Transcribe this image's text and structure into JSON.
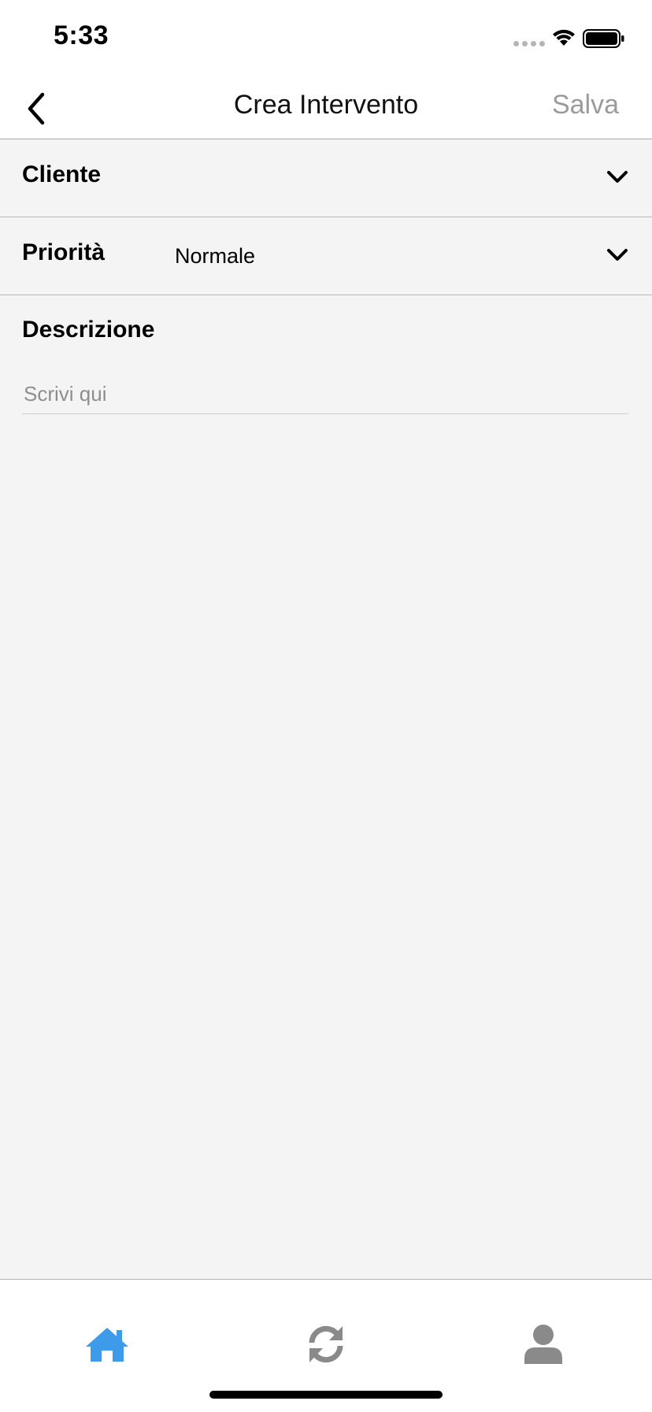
{
  "status_bar": {
    "time": "5:33"
  },
  "nav": {
    "title": "Crea Intervento",
    "save_label": "Salva",
    "back_icon": "chevron-left-icon"
  },
  "form": {
    "cliente": {
      "label": "Cliente",
      "value": ""
    },
    "priorita": {
      "label": "Priorità",
      "value": "Normale"
    },
    "descrizione": {
      "label": "Descrizione",
      "placeholder": "Scrivi qui",
      "value": ""
    }
  },
  "tab_bar": {
    "tabs": [
      {
        "icon": "home-icon",
        "active": true
      },
      {
        "icon": "sync-icon",
        "active": false
      },
      {
        "icon": "user-icon",
        "active": false
      }
    ]
  },
  "colors": {
    "accent": "#3d9be9",
    "inactive_tab": "#8a8a8a",
    "save_disabled": "#9b9b9b",
    "background": "#f4f4f4"
  }
}
